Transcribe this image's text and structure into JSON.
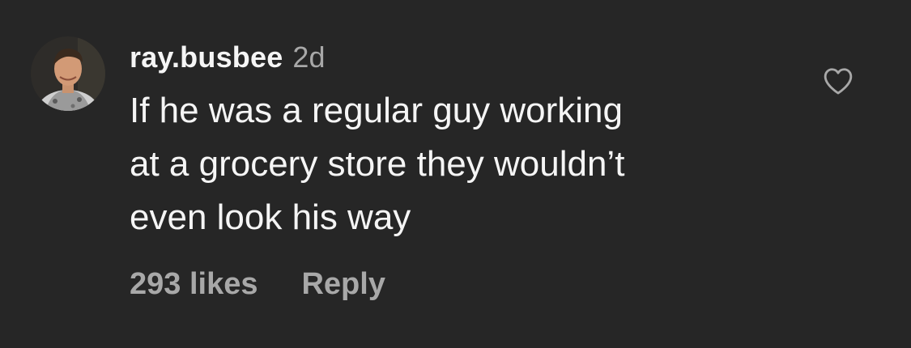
{
  "comment": {
    "username": "ray.busbee",
    "timestamp": "2d",
    "lines": [
      "If he was a regular guy working",
      "at a grocery store they wouldn’t",
      "even look his way"
    ],
    "likes_label": "293 likes",
    "reply_label": "Reply",
    "like_icon": "heart-outline-icon",
    "avatar_icon": "user-avatar"
  },
  "colors": {
    "background": "#262626",
    "primary_text": "#f5f5f5",
    "secondary_text": "#a8a8a8"
  }
}
